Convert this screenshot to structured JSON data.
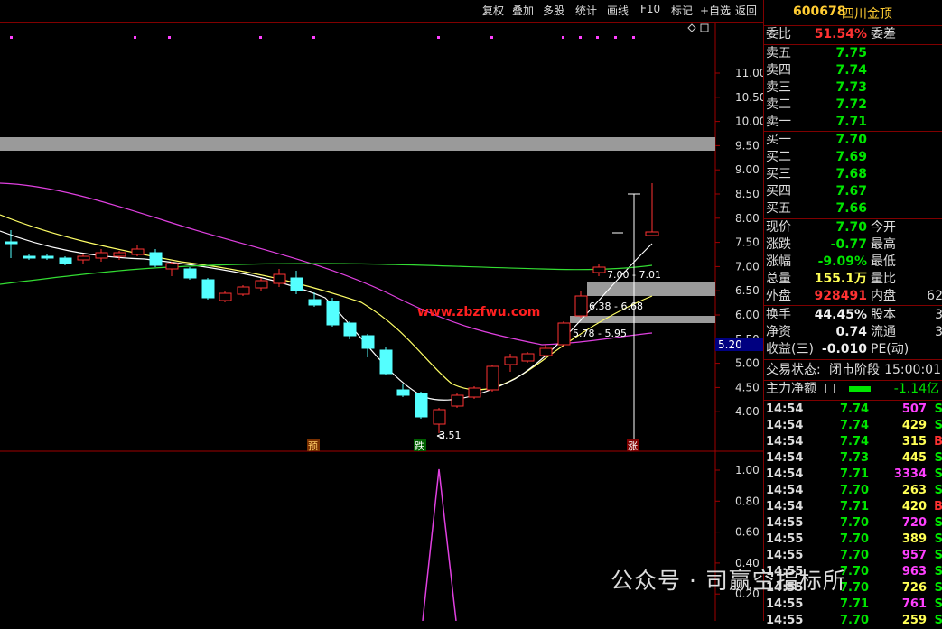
{
  "toolbar": {
    "buttons": [
      "复权",
      "叠加",
      "多股",
      "统计",
      "画线",
      "F10",
      "标记",
      "+自选",
      "返回"
    ]
  },
  "price_axis": [
    "11.00",
    "10.50",
    "10.00",
    "9.50",
    "9.00",
    "8.50",
    "8.00",
    "7.50",
    "7.00",
    "6.50",
    "6.00",
    "5.50",
    "5.00",
    "4.50",
    "4.00"
  ],
  "current_price_tag": "5.20",
  "indicator_axis": [
    "1.00",
    "0.80",
    "0.60",
    "0.40",
    "0.20"
  ],
  "chart_labels": {
    "zone_top": "7.00 - 7.01",
    "zone_mid": "6.38 - 6.68",
    "zone_low": "5.78 - 5.95",
    "low_mark": "3.51",
    "website": "www.zbzfwu.com",
    "marker_yu": "预",
    "marker_die": "跌",
    "marker_zhang": "涨"
  },
  "panel": {
    "code": "600678",
    "name": "四川金顶",
    "weibi_label": "委比",
    "weibi_value": "51.54%",
    "weicha_label": "委差",
    "sell": [
      {
        "label": "卖五",
        "price": "7.75"
      },
      {
        "label": "卖四",
        "price": "7.74"
      },
      {
        "label": "卖三",
        "price": "7.73"
      },
      {
        "label": "卖二",
        "price": "7.72"
      },
      {
        "label": "卖一",
        "price": "7.71"
      }
    ],
    "buy": [
      {
        "label": "买一",
        "price": "7.70"
      },
      {
        "label": "买二",
        "price": "7.69"
      },
      {
        "label": "买三",
        "price": "7.68"
      },
      {
        "label": "买四",
        "price": "7.67"
      },
      {
        "label": "买五",
        "price": "7.66"
      }
    ],
    "quote": [
      {
        "l1": "现价",
        "v1": "7.70",
        "l2": "今开",
        "v2": ""
      },
      {
        "l1": "涨跌",
        "v1": "-0.77",
        "l2": "最高",
        "v2": ""
      },
      {
        "l1": "涨幅",
        "v1": "-9.09%",
        "l2": "最低",
        "v2": ""
      },
      {
        "l1": "总量",
        "v1": "155.1万",
        "l2": "量比",
        "v2": ""
      },
      {
        "l1": "外盘",
        "v1": "928491",
        "l2": "内盘",
        "v2": "62"
      }
    ],
    "stats": [
      {
        "l1": "换手",
        "v1": "44.45%",
        "l2": "股本",
        "v2": "3"
      },
      {
        "l1": "净资",
        "v1": "0.74",
        "l2": "流通",
        "v2": "3"
      },
      {
        "l1": "收益(三)",
        "v1": "-0.010",
        "l2": "PE(动)",
        "v2": ""
      }
    ],
    "status_label": "交易状态:",
    "status_value": "闭市阶段",
    "status_time": "15:00:01",
    "main_flow_label": "主力净额",
    "main_flow_value": "-1.14亿",
    "ticks": [
      {
        "time": "14:54",
        "price": "7.74",
        "vol": "507",
        "flag": "S"
      },
      {
        "time": "14:54",
        "price": "7.74",
        "vol": "429",
        "flag": "S"
      },
      {
        "time": "14:54",
        "price": "7.74",
        "vol": "315",
        "flag": "B"
      },
      {
        "time": "14:54",
        "price": "7.73",
        "vol": "445",
        "flag": "S"
      },
      {
        "time": "14:54",
        "price": "7.71",
        "vol": "3334",
        "flag": "S"
      },
      {
        "time": "14:54",
        "price": "7.70",
        "vol": "263",
        "flag": "S"
      },
      {
        "time": "14:54",
        "price": "7.71",
        "vol": "420",
        "flag": "B"
      },
      {
        "time": "14:55",
        "price": "7.70",
        "vol": "720",
        "flag": "S"
      },
      {
        "time": "14:55",
        "price": "7.70",
        "vol": "389",
        "flag": "S"
      },
      {
        "time": "14:55",
        "price": "7.70",
        "vol": "957",
        "flag": "S"
      },
      {
        "time": "14:55",
        "price": "7.70",
        "vol": "963",
        "flag": "S"
      },
      {
        "time": "14:55",
        "price": "7.70",
        "vol": "726",
        "flag": "S"
      },
      {
        "time": "14:55",
        "price": "7.71",
        "vol": "761",
        "flag": "S"
      },
      {
        "time": "14:55",
        "price": "7.70",
        "vol": "259",
        "flag": "S"
      }
    ]
  },
  "watermark": "公众号 · 司赢空指标所"
}
